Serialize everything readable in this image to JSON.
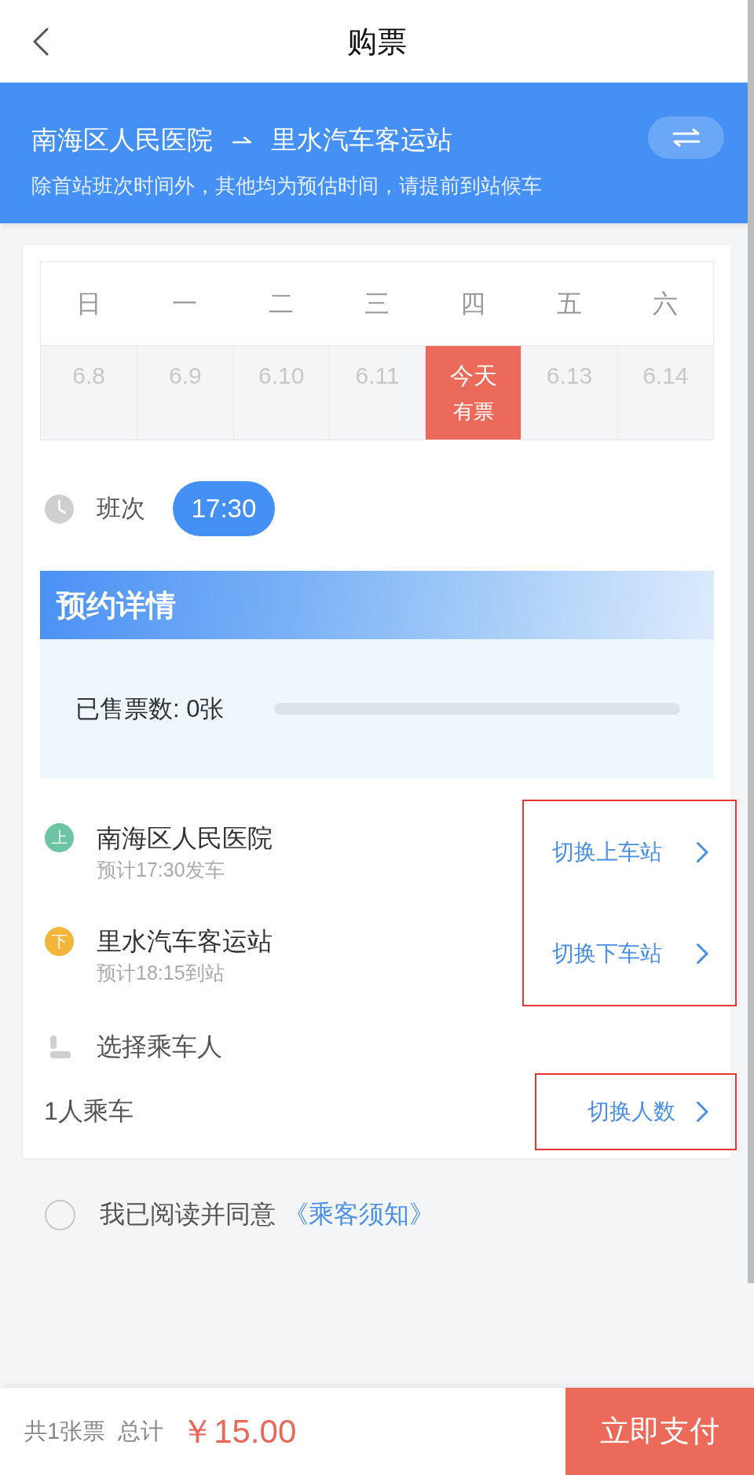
{
  "header": {
    "title": "购票"
  },
  "route": {
    "origin": "南海区人民医院",
    "destination": "里水汽车客运站",
    "note": "除首站班次时间外，其他均为预估时间，请提前到站候车"
  },
  "calendar": {
    "weekdays": [
      "日",
      "一",
      "二",
      "三",
      "四",
      "五",
      "六"
    ],
    "days": [
      {
        "label": "6.8",
        "selected": false
      },
      {
        "label": "6.9",
        "selected": false
      },
      {
        "label": "6.10",
        "selected": false
      },
      {
        "label": "6.11",
        "selected": false
      },
      {
        "label": "今天",
        "status": "有票",
        "selected": true
      },
      {
        "label": "6.13",
        "selected": false
      },
      {
        "label": "6.14",
        "selected": false
      }
    ]
  },
  "schedule": {
    "label": "班次",
    "times": [
      {
        "label": "17:30",
        "selected": true
      }
    ]
  },
  "details": {
    "title": "预约详情",
    "sold": "已售票数: 0张",
    "level": 0
  },
  "stations": {
    "highlighted": true,
    "items": [
      {
        "badge": "上",
        "color": "#6cc4a3",
        "name": "南海区人民医院",
        "time": "预计17:30发车",
        "action": "切换上车站"
      },
      {
        "badge": "下",
        "color": "#f2b63c",
        "name": "里水汽车客运站",
        "time": "预计18:15到站",
        "action": "切换下车站"
      }
    ]
  },
  "passengers": {
    "label": "选择乘车人",
    "count": "1人乘车",
    "action": "切换人数",
    "highlighted": true
  },
  "agreement": {
    "checked": false,
    "text": "我已阅读并同意",
    "link": "《乘客须知》"
  },
  "footer": {
    "count": "共1张票",
    "total_label": "总计",
    "price": "￥15.00",
    "pay": "立即支付"
  }
}
